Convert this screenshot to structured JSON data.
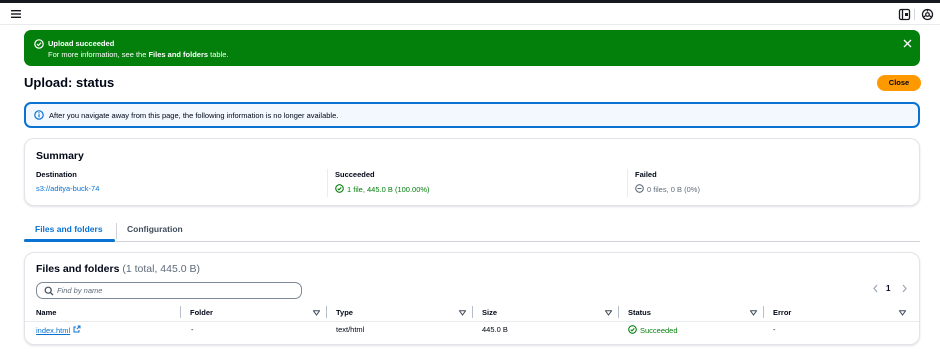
{
  "header": {
    "menu_icon": "hamburger-menu-icon",
    "right_icons": [
      "panel-icon",
      "settings-icon"
    ]
  },
  "flash": {
    "title": "Upload succeeded",
    "message_prefix": "For more information, see the ",
    "message_bold": "Files and folders",
    "message_suffix": " table.",
    "color": "#037f0c"
  },
  "page": {
    "title": "Upload: status",
    "close_label": "Close",
    "close_color": "#ff9900"
  },
  "info": {
    "text": "After you navigate away from this page, the following information is no longer available."
  },
  "summary": {
    "title": "Summary",
    "destination_label": "Destination",
    "destination_value": "s3://aditya-buck-74",
    "succeeded_label": "Succeeded",
    "succeeded_value": "1 file, 445.0 B (100.00%)",
    "failed_label": "Failed",
    "failed_value": "0 files, 0 B (0%)"
  },
  "tabs": [
    {
      "label": "Files and folders",
      "active": true
    },
    {
      "label": "Configuration",
      "active": false
    }
  ],
  "files": {
    "title": "Files and folders",
    "count": "(1 total, 445.0 B)",
    "search_placeholder": "Find by name",
    "page_number": "1",
    "columns": [
      "Name",
      "Folder",
      "Type",
      "Size",
      "Status",
      "Error"
    ],
    "rows": [
      {
        "name": "index.html",
        "folder": "-",
        "type": "text/html",
        "size": "445.0 B",
        "status": "Succeeded",
        "error": "-"
      }
    ]
  },
  "colors": {
    "link": "#0972d3",
    "success": "#037f0c",
    "text": "#000716"
  }
}
